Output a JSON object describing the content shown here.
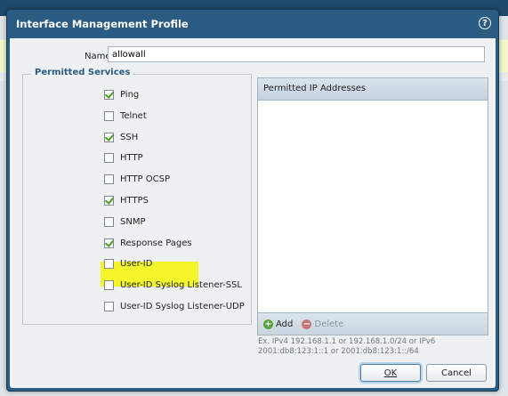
{
  "dialog": {
    "title": "Interface Management Profile",
    "help_icon": "?"
  },
  "name_field": {
    "label": "Name",
    "value": "allowall"
  },
  "permitted_services": {
    "legend": "Permitted Services",
    "items": [
      {
        "label": "Ping",
        "checked": true
      },
      {
        "label": "Telnet",
        "checked": false
      },
      {
        "label": "SSH",
        "checked": true
      },
      {
        "label": "HTTP",
        "checked": false
      },
      {
        "label": "HTTP OCSP",
        "checked": false
      },
      {
        "label": "HTTPS",
        "checked": true
      },
      {
        "label": "SNMP",
        "checked": false
      },
      {
        "label": "Response Pages",
        "checked": true,
        "highlighted": true
      },
      {
        "label": "User-ID",
        "checked": false
      },
      {
        "label": "User-ID Syslog Listener-SSL",
        "checked": false
      },
      {
        "label": "User-ID Syslog Listener-UDP",
        "checked": false
      }
    ]
  },
  "ip_panel": {
    "header": "Permitted IP Addresses",
    "add_label": "Add",
    "delete_label": "Delete",
    "hint": "Ex. IPv4 192.168.1.1 or 192.168.1.0/24 or IPv6 2001:db8:123:1::1 or 2001:db8:123:1::/64"
  },
  "buttons": {
    "ok": "OK",
    "cancel": "Cancel"
  },
  "colors": {
    "title_bar": "#2a5b82",
    "highlight": "#f3f52a",
    "check": "#4ca023"
  }
}
